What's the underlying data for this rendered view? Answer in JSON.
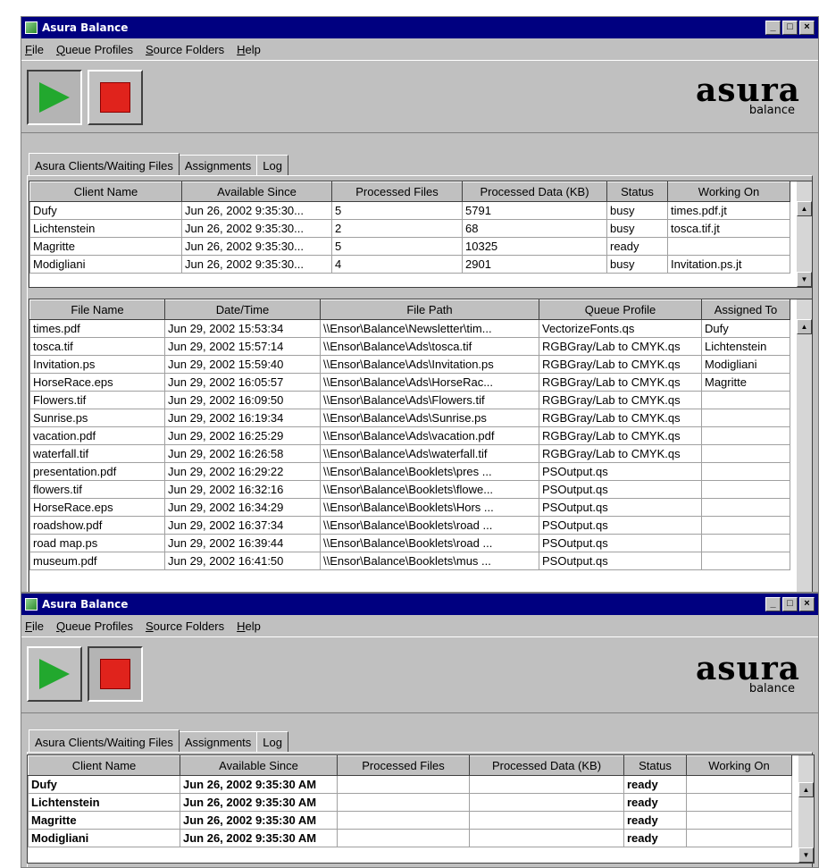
{
  "window1": {
    "title": "Asura Balance",
    "menu": [
      "File",
      "Queue Profiles",
      "Source Folders",
      "Help"
    ],
    "logo_main": "asura",
    "logo_sub": "balance",
    "tabs": [
      "Asura Clients/Waiting Files",
      "Assignments",
      "Log"
    ],
    "clients": {
      "headers": [
        "Client Name",
        "Available Since",
        "Processed Files",
        "Processed Data (KB)",
        "Status",
        "Working On"
      ],
      "rows": [
        [
          "Dufy",
          "Jun 26, 2002 9:35:30...",
          "5",
          "5791",
          "busy",
          "times.pdf.jt"
        ],
        [
          "Lichtenstein",
          "Jun 26, 2002 9:35:30...",
          "2",
          "68",
          "busy",
          "tosca.tif.jt"
        ],
        [
          "Magritte",
          "Jun 26, 2002 9:35:30...",
          "5",
          "10325",
          "ready",
          ""
        ],
        [
          "Modigliani",
          "Jun 26, 2002 9:35:30...",
          "4",
          "2901",
          "busy",
          "Invitation.ps.jt"
        ]
      ]
    },
    "files": {
      "headers": [
        "File Name",
        "Date/Time",
        "File Path",
        "Queue Profile",
        "Assigned To"
      ],
      "rows": [
        [
          "times.pdf",
          "Jun 29, 2002 15:53:34",
          "\\\\Ensor\\Balance\\Newsletter\\tim...",
          "VectorizeFonts.qs",
          "Dufy"
        ],
        [
          "tosca.tif",
          "Jun 29, 2002 15:57:14",
          "\\\\Ensor\\Balance\\Ads\\tosca.tif",
          "RGBGray/Lab to CMYK.qs",
          "Lichtenstein"
        ],
        [
          "Invitation.ps",
          "Jun 29, 2002 15:59:40",
          "\\\\Ensor\\Balance\\Ads\\Invitation.ps",
          "RGBGray/Lab to CMYK.qs",
          "Modigliani"
        ],
        [
          "HorseRace.eps",
          "Jun 29, 2002 16:05:57",
          "\\\\Ensor\\Balance\\Ads\\HorseRac...",
          "RGBGray/Lab to CMYK.qs",
          "Magritte"
        ],
        [
          "Flowers.tif",
          "Jun 29, 2002 16:09:50",
          "\\\\Ensor\\Balance\\Ads\\Flowers.tif",
          "RGBGray/Lab to CMYK.qs",
          ""
        ],
        [
          "Sunrise.ps",
          "Jun 29, 2002 16:19:34",
          "\\\\Ensor\\Balance\\Ads\\Sunrise.ps",
          "RGBGray/Lab to CMYK.qs",
          ""
        ],
        [
          "vacation.pdf",
          "Jun 29, 2002 16:25:29",
          "\\\\Ensor\\Balance\\Ads\\vacation.pdf",
          "RGBGray/Lab to CMYK.qs",
          ""
        ],
        [
          "waterfall.tif",
          "Jun 29, 2002 16:26:58",
          "\\\\Ensor\\Balance\\Ads\\waterfall.tif",
          "RGBGray/Lab to CMYK.qs",
          ""
        ],
        [
          "presentation.pdf",
          "Jun 29, 2002 16:29:22",
          "\\\\Ensor\\Balance\\Booklets\\pres ...",
          "PSOutput.qs",
          ""
        ],
        [
          "flowers.tif",
          "Jun 29, 2002 16:32:16",
          "\\\\Ensor\\Balance\\Booklets\\flowe...",
          "PSOutput.qs",
          ""
        ],
        [
          "HorseRace.eps",
          "Jun 29, 2002 16:34:29",
          "\\\\Ensor\\Balance\\Booklets\\Hors ...",
          "PSOutput.qs",
          ""
        ],
        [
          "roadshow.pdf",
          "Jun 29, 2002 16:37:34",
          "\\\\Ensor\\Balance\\Booklets\\road ...",
          "PSOutput.qs",
          ""
        ],
        [
          "road map.ps",
          "Jun 29, 2002 16:39:44",
          "\\\\Ensor\\Balance\\Booklets\\road ...",
          "PSOutput.qs",
          ""
        ],
        [
          "museum.pdf",
          "Jun 29, 2002 16:41:50",
          "\\\\Ensor\\Balance\\Booklets\\mus ...",
          "PSOutput.qs",
          ""
        ]
      ]
    }
  },
  "window2": {
    "title": "Asura Balance",
    "menu": [
      "File",
      "Queue Profiles",
      "Source Folders",
      "Help"
    ],
    "logo_main": "asura",
    "logo_sub": "balance",
    "tabs": [
      "Asura Clients/Waiting Files",
      "Assignments",
      "Log"
    ],
    "clients": {
      "headers": [
        "Client Name",
        "Available Since",
        "Processed Files",
        "Processed Data (KB)",
        "Status",
        "Working On"
      ],
      "rows": [
        [
          "Dufy",
          "Jun 26, 2002 9:35:30 AM",
          "",
          "",
          "ready",
          ""
        ],
        [
          "Lichtenstein",
          "Jun 26, 2002 9:35:30 AM",
          "",
          "",
          "ready",
          ""
        ],
        [
          "Magritte",
          "Jun 26, 2002 9:35:30 AM",
          "",
          "",
          "ready",
          ""
        ],
        [
          "Modigliani",
          "Jun 26, 2002 9:35:30 AM",
          "",
          "",
          "ready",
          ""
        ]
      ]
    }
  },
  "colors": {
    "titlebar": "#000080",
    "chrome": "#c0c0c0",
    "play": "#22a82e",
    "stop": "#e0231c"
  }
}
